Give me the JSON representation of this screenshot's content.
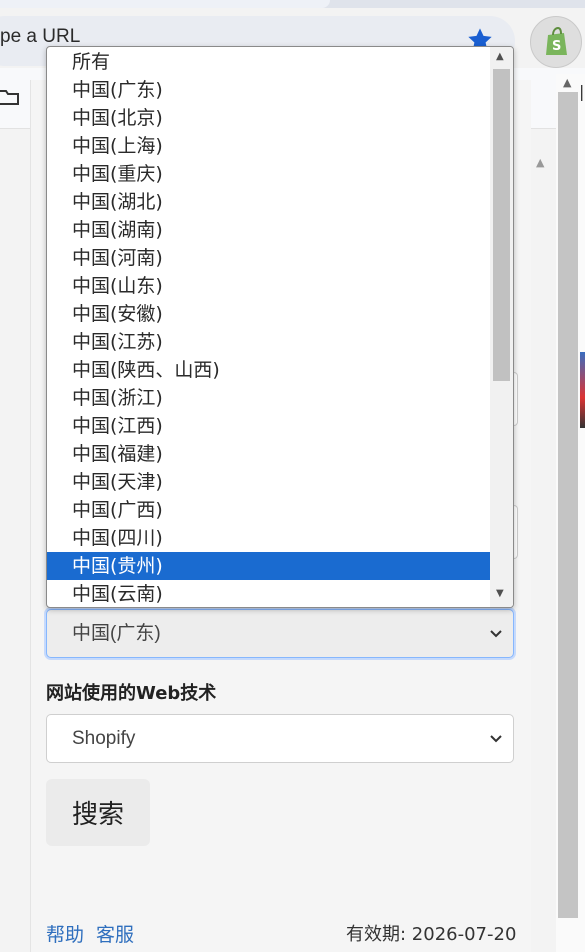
{
  "browser": {
    "omnibox_placeholder": "pe a URL",
    "star_icon": "bookmark-star-icon",
    "extension_icon": "shopify-bag-icon",
    "colors": {
      "star": "#1a5fd1",
      "shopify": "#7ab55c"
    }
  },
  "filters": {
    "region_label_selected": "中国(广东)",
    "tech_label": "网站使用的Web技术",
    "tech_selected": "Shopify",
    "search_button": "搜索"
  },
  "dropdown": {
    "options": [
      "所有",
      "中国(广东)",
      "中国(北京)",
      "中国(上海)",
      "中国(重庆)",
      "中国(湖北)",
      "中国(湖南)",
      "中国(河南)",
      "中国(山东)",
      "中国(安徽)",
      "中国(江苏)",
      "中国(陕西、山西)",
      "中国(浙江)",
      "中国(江西)",
      "中国(福建)",
      "中国(天津)",
      "中国(广西)",
      "中国(四川)",
      "中国(贵州)",
      "中国(云南)"
    ],
    "highlighted_index": 18,
    "highlight_color": "#1a6bd0"
  },
  "footer": {
    "help": "帮助",
    "support": "客服",
    "expiry": "有效期: 2026-07-20"
  }
}
